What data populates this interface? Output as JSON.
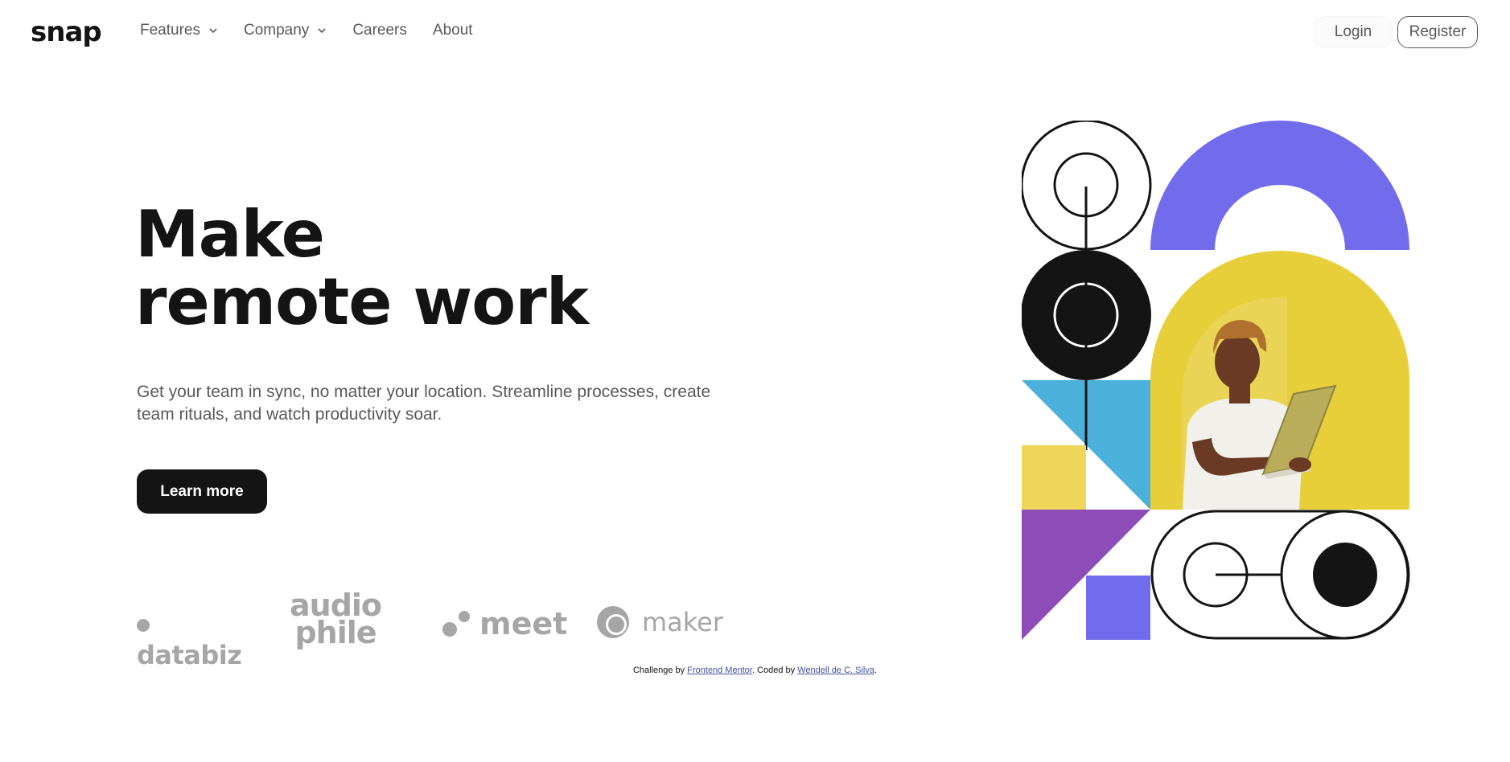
{
  "header": {
    "logo": "snap",
    "nav": [
      {
        "label": "Features",
        "has_dropdown": true
      },
      {
        "label": "Company",
        "has_dropdown": true
      },
      {
        "label": "Careers",
        "has_dropdown": false
      },
      {
        "label": "About",
        "has_dropdown": false
      }
    ],
    "login_label": "Login",
    "register_label": "Register"
  },
  "hero": {
    "title_line1": "Make",
    "title_line2": "remote work",
    "description_line1": "Get your team in sync, no matter your location. Streamline processes, create",
    "description_line2": "team rituals, and watch productivity soar.",
    "cta_label": "Learn more"
  },
  "clients": {
    "databiz": "databiz",
    "audiophile_line1": "audio",
    "audiophile_line2": "phile",
    "meet": "meet",
    "maker": "maker"
  },
  "footer": {
    "prefix": "Challenge by ",
    "frontend_mentor": "Frontend Mentor",
    "middle": ". Coded by ",
    "author": "Wendell de C. Silva",
    "suffix": "."
  },
  "colors": {
    "dark": "#141414",
    "gray": "#595959",
    "logo_gray": "#a6a6a6",
    "purple_blue": "#726ced",
    "yellow": "#e7cf3a",
    "light_yellow": "#edd65a",
    "sky_blue": "#4bb0da",
    "purple": "#8d4cb8",
    "link": "#3e52a3"
  },
  "icons": [
    "chevron-down-icon",
    "person-with-laptop-photo"
  ]
}
